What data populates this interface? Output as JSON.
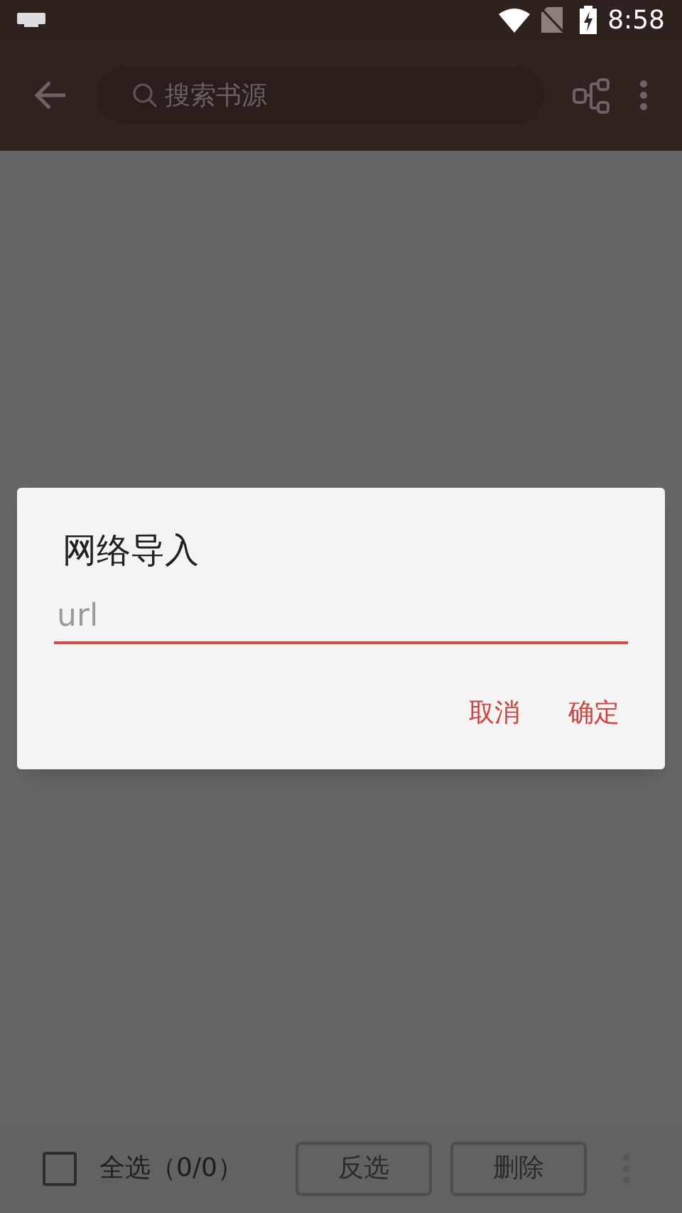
{
  "status_bar": {
    "time": "8:58"
  },
  "toolbar": {
    "search": {
      "placeholder": "搜索书源"
    }
  },
  "dialog": {
    "title": "网络导入",
    "field": {
      "placeholder": "url"
    },
    "buttons": [
      "取消",
      "确定"
    ]
  },
  "bottom_bar": {
    "select_all": {
      "label": "全选（0/0）",
      "checked": false
    },
    "buttons": [
      "反选",
      "删除"
    ]
  }
}
